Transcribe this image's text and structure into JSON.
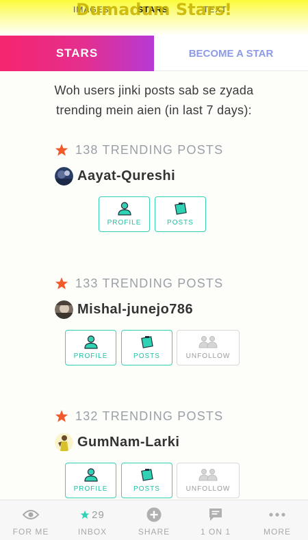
{
  "header": {
    "brand_title": "Dumadum Stars!",
    "tabs": [
      {
        "label": "IMAGES",
        "active": false
      },
      {
        "label": "STARS",
        "active": true
      },
      {
        "label": "TEXT",
        "active": false
      }
    ]
  },
  "segment_tabs": {
    "stars_label": "STARS",
    "become_label": "BECOME A STAR"
  },
  "intro": {
    "line1": "Woh users jinki posts sab se zyada",
    "line2": "trending mein aien (in last 7 days):"
  },
  "stars": [
    {
      "trending": "138 TRENDING POSTS",
      "username": "Aayat-Qureshi",
      "buttons": {
        "profile": "PROFILE",
        "posts": "POSTS"
      }
    },
    {
      "trending": "133 TRENDING POSTS",
      "username": "Mishal-junejo786",
      "buttons": {
        "profile": "PROFILE",
        "posts": "POSTS",
        "unfollow": "UNFOLLOW"
      }
    },
    {
      "trending": "132 TRENDING POSTS",
      "username": "GumNam-Larki",
      "buttons": {
        "profile": "PROFILE",
        "posts": "POSTS",
        "unfollow": "UNFOLLOW"
      }
    }
  ],
  "bottom_nav": [
    {
      "label": "FOR ME",
      "icon": "eye-icon"
    },
    {
      "label": "INBOX",
      "icon": "star-icon",
      "count": "29"
    },
    {
      "label": "SHARE",
      "icon": "plus-circle-icon"
    },
    {
      "label": "1 ON 1",
      "icon": "chat-bubble-icon"
    },
    {
      "label": "MORE",
      "icon": "more-dots-icon"
    }
  ],
  "colors": {
    "accent_teal": "#2fd3b4",
    "star_orange": "#f15a2b",
    "header_yellow": "#fbfb3a",
    "stars_tab_gradient_start": "#f5256e",
    "stars_tab_gradient_end": "#b63ad6",
    "become_tab_text": "#8d9be6"
  }
}
